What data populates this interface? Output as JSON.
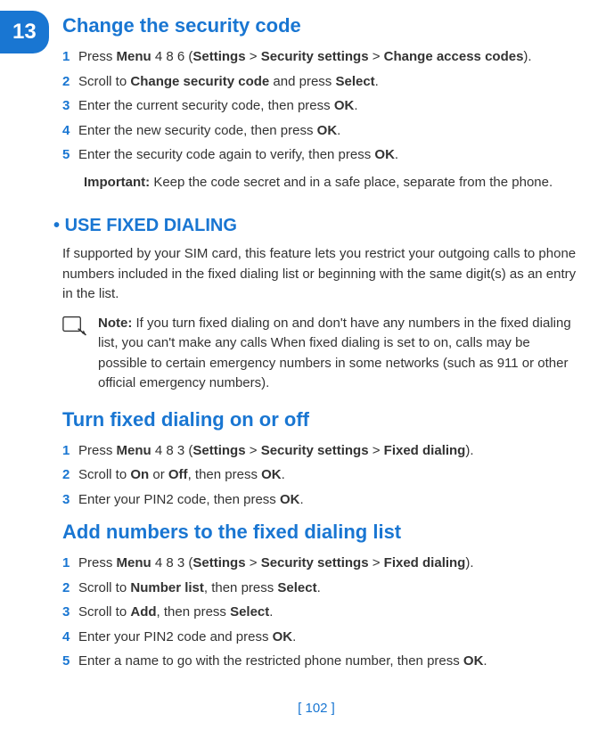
{
  "tab": "13",
  "sections": {
    "changeSecurityCode": {
      "title": "Change the security code",
      "steps": [
        {
          "n": "1",
          "parts": [
            "Press ",
            {
              "b": "Menu"
            },
            " 4 8 6 (",
            {
              "b": "Settings"
            },
            " > ",
            {
              "b": "Security settings"
            },
            " > ",
            {
              "b": "Change access codes"
            },
            ")."
          ]
        },
        {
          "n": "2",
          "parts": [
            "Scroll to ",
            {
              "b": "Change security code"
            },
            " and press ",
            {
              "b": "Select"
            },
            "."
          ]
        },
        {
          "n": "3",
          "parts": [
            "Enter the current security code, then press ",
            {
              "b": "OK"
            },
            "."
          ]
        },
        {
          "n": "4",
          "parts": [
            "Enter the new security code, then press ",
            {
              "b": "OK"
            },
            "."
          ]
        },
        {
          "n": "5",
          "parts": [
            "Enter the security code again to verify, then press ",
            {
              "b": "OK"
            },
            "."
          ]
        }
      ],
      "importantLabel": "Important:",
      "importantText": " Keep the code secret and in a safe place, separate from the phone."
    },
    "useFixedDialing": {
      "heading": "USE FIXED DIALING",
      "intro": "If supported by your SIM card, this feature lets you restrict your outgoing calls to phone numbers included in the fixed dialing list or beginning with the same digit(s) as an entry in the list.",
      "noteLabel": "Note:",
      "noteText": " If you turn fixed dialing on and don't have any numbers in the fixed dialing list, you can't make any calls When fixed dialing is set to on, calls may be possible to certain emergency numbers in some networks (such as 911 or other official emergency numbers)."
    },
    "turnFixedDialing": {
      "title": "Turn fixed dialing on or off",
      "steps": [
        {
          "n": "1",
          "parts": [
            "Press ",
            {
              "b": "Menu"
            },
            " 4 8 3 (",
            {
              "b": "Settings"
            },
            " > ",
            {
              "b": "Security settings"
            },
            " > ",
            {
              "b": "Fixed dialing"
            },
            ")."
          ]
        },
        {
          "n": "2",
          "parts": [
            "Scroll to ",
            {
              "b": "On"
            },
            " or ",
            {
              "b": "Off"
            },
            ", then press ",
            {
              "b": "OK"
            },
            "."
          ]
        },
        {
          "n": "3",
          "parts": [
            "Enter your PIN2 code, then press ",
            {
              "b": "OK"
            },
            "."
          ]
        }
      ]
    },
    "addNumbers": {
      "title": "Add numbers to the fixed dialing list",
      "steps": [
        {
          "n": "1",
          "parts": [
            "Press ",
            {
              "b": "Menu"
            },
            " 4 8 3 (",
            {
              "b": "Settings"
            },
            " > ",
            {
              "b": "Security settings"
            },
            " > ",
            {
              "b": "Fixed dialing"
            },
            ")."
          ]
        },
        {
          "n": "2",
          "parts": [
            "Scroll to ",
            {
              "b": "Number list"
            },
            ", then press ",
            {
              "b": "Select"
            },
            "."
          ]
        },
        {
          "n": "3",
          "parts": [
            "Scroll to ",
            {
              "b": "Add"
            },
            ", then press ",
            {
              "b": "Select"
            },
            "."
          ]
        },
        {
          "n": "4",
          "parts": [
            "Enter your PIN2 code and press ",
            {
              "b": "OK"
            },
            "."
          ]
        },
        {
          "n": "5",
          "parts": [
            "Enter a name to go with the restricted phone number, then press ",
            {
              "b": "OK"
            },
            "."
          ]
        }
      ]
    }
  },
  "footer": "[ 102 ]"
}
